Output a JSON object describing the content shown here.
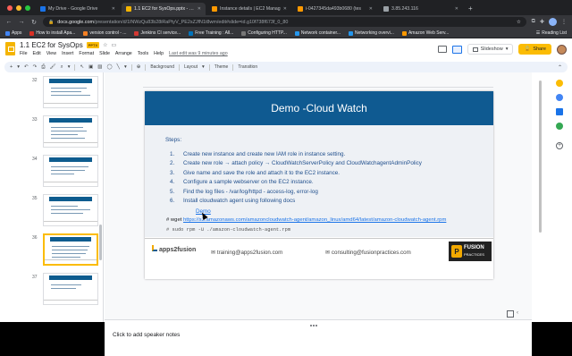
{
  "browser": {
    "tabs": [
      {
        "title": "My Drive - Google Drive",
        "favicon_color": "#1a73e8",
        "active": false
      },
      {
        "title": "1.1 EC2 for SysOps.pptx - Goo",
        "favicon_color": "#f4b400",
        "active": true
      },
      {
        "title": "Instance details | EC2 Manag",
        "favicon_color": "#ff9900",
        "active": false
      },
      {
        "title": "i-0427345da493b0680 (tes",
        "favicon_color": "#ff9900",
        "active": false
      },
      {
        "title": "3.85.243.116",
        "favicon_color": "#9aa0a6",
        "active": false
      }
    ],
    "url_host": "docs.google.com",
    "url_path": "/presentation/d/1lNWzQu83b28iRaPtyV_PE2sZJfN1t8wm/edit#slide=id.g10f738f673f_0_80",
    "bookmarks": [
      {
        "label": "Apps",
        "color": "#4285f4"
      },
      {
        "label": "How to install Apa...",
        "color": "#d93025"
      },
      {
        "label": "version control - ...",
        "color": "#f48024"
      },
      {
        "label": "Jenkins CI service...",
        "color": "#d33833"
      },
      {
        "label": "Free Training : All...",
        "color": "#0073bb"
      },
      {
        "label": "Configuring HTTP...",
        "color": "#777777"
      },
      {
        "label": "Network container...",
        "color": "#2496ed"
      },
      {
        "label": "Networking overvi...",
        "color": "#2496ed"
      },
      {
        "label": "Amazon Web Serv...",
        "color": "#ff9900"
      }
    ],
    "reading_list": "Reading List"
  },
  "slides_app": {
    "doc_title": "1.1 EC2 for SysOps",
    "file_badge": "PPTX",
    "menus": [
      "File",
      "Edit",
      "View",
      "Insert",
      "Format",
      "Slide",
      "Arrange",
      "Tools",
      "Help"
    ],
    "last_edit": "Last edit was 9 minutes ago",
    "slideshow_label": "Slideshow",
    "share_label": "Share",
    "toolbar": {
      "background_label": "Background",
      "layout_label": "Layout",
      "theme_label": "Theme",
      "transition_label": "Transition"
    },
    "filmstrip": [
      {
        "num": "32",
        "selected": false
      },
      {
        "num": "33",
        "selected": false
      },
      {
        "num": "34",
        "selected": false
      },
      {
        "num": "35",
        "selected": false
      },
      {
        "num": "36",
        "selected": true
      },
      {
        "num": "37",
        "selected": false
      }
    ],
    "speaker_notes_placeholder": "Click to add speaker notes"
  },
  "slide": {
    "title": "Demo -Cloud Watch",
    "steps_heading": "Steps:",
    "steps": [
      {
        "num": "1.",
        "text": "Create new instance and create new IAM role in instance setting."
      },
      {
        "num": "2.",
        "text": "Create new role → attach policy → CloudWatchServerPolicy and CloudWatchagentAdminPolicy"
      },
      {
        "num": "3.",
        "text": "Give name and save the role and attach it to the EC2 instance."
      },
      {
        "num": "4.",
        "text": "Configure a sample webserver on the EC2 instance."
      },
      {
        "num": "5.",
        "text": "Find the log files - /var/log/httpd - access-log, error-log"
      },
      {
        "num": "6.",
        "text": "Install cloudwatch agent using following docs"
      }
    ],
    "demo_link": "Demo",
    "wget_prefix": "# wget ",
    "wget_url": "https://s3.amazonaws.com/amazoncloudwatch-agent/amazon_linux/amd64/latest/amazon-cloudwatch-agent.rpm",
    "rpm_cmd": "# sudo rpm -U ./amazon-cloudwatch-agent.rpm",
    "footer": {
      "brand": "apps2fusion",
      "email1": "training@apps2fusion.com",
      "email2": "consulting@fusionpractices.com",
      "fusion_top": "FUSION",
      "fusion_bottom": "PRACTICES"
    },
    "colors": {
      "title_band": "#0f5a91",
      "text": "#1f4e8c",
      "link": "#1a73e8"
    }
  }
}
